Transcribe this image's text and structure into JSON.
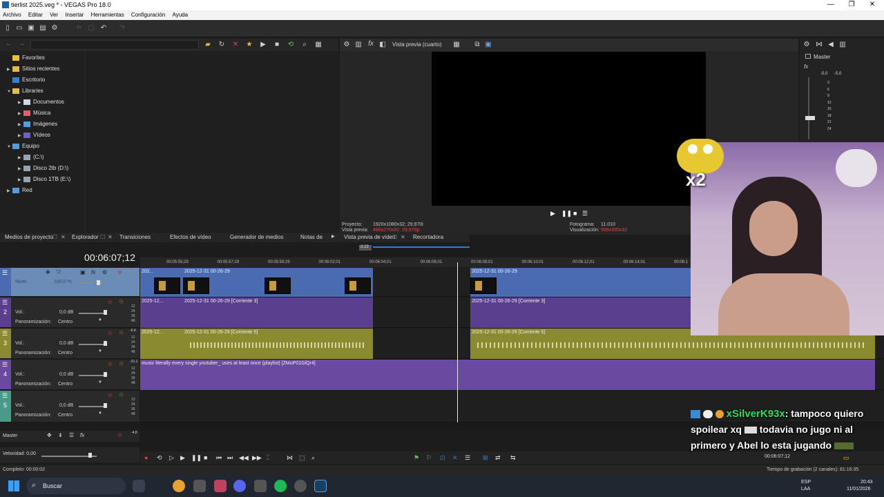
{
  "window": {
    "title": "tierlist 2025.veg * - VEGAS Pro 18.0",
    "controls": [
      "—",
      "❐",
      "✕"
    ]
  },
  "menu": [
    "Archivo",
    "Editar",
    "Ver",
    "Insertar",
    "Herramientas",
    "Configuración",
    "Ayuda"
  ],
  "explorer": {
    "tree": [
      {
        "label": "Favorites",
        "level": 1,
        "icon": "star-icon"
      },
      {
        "label": "Sitios recientes",
        "level": 1,
        "icon": "folder-icon"
      },
      {
        "label": "Escritorio",
        "level": 1,
        "icon": "desktop-icon"
      },
      {
        "label": "Libraries",
        "level": 1,
        "icon": "folder-icon"
      },
      {
        "label": "Documentos",
        "level": 2,
        "icon": "documents-icon"
      },
      {
        "label": "Música",
        "level": 2,
        "icon": "music-icon"
      },
      {
        "label": "Imágenes",
        "level": 2,
        "icon": "images-icon"
      },
      {
        "label": "Vídeos",
        "level": 2,
        "icon": "videos-icon"
      },
      {
        "label": "Equipo",
        "level": 1,
        "icon": "computer-icon"
      },
      {
        "label": "(C:\\)",
        "level": 2,
        "icon": "drive-icon"
      },
      {
        "label": "Disco 2tb (D:\\)",
        "level": 2,
        "icon": "drive-icon"
      },
      {
        "label": "Disco 1TB (E:\\)",
        "level": 2,
        "icon": "drive-icon"
      },
      {
        "label": "Red",
        "level": 1,
        "icon": "network-icon"
      }
    ]
  },
  "tabs": {
    "items": [
      "Medios de proyecto",
      "Explorador",
      "Transiciones",
      "Efectos de vídeo",
      "Generador de medios",
      "Notas de"
    ],
    "preview_tabs": [
      "Vista previa de vídeo",
      "Recortadora"
    ]
  },
  "preview": {
    "mode_label": "Vista previa (cuarto)",
    "project_label": "Proyecto:",
    "project_value": "1920x1080x32; 29,970i",
    "preview_label": "Vista previa:",
    "preview_value": "480x270x32; 29,970p",
    "frame_label": "Fotograma:",
    "frame_value": "11.010",
    "display_label": "Visualización:",
    "display_value": "596x335x32"
  },
  "master_bus": {
    "label": "Master",
    "peak_left": "-5,0",
    "peak_right": "-5,0",
    "scale": [
      "3",
      "6",
      "9",
      "12",
      "15",
      "18",
      "21",
      "24"
    ]
  },
  "timeline": {
    "timecode": "00:06:07;12",
    "ruler": [
      "00:05:55;29",
      "00:05:57;29",
      "00:05:59;29",
      "00:06:02;01",
      "00:06:04;01",
      "00:06:06;01",
      "00:06:08;01",
      "00:06:10;01",
      "00:06:12;01",
      "00:06:14;01",
      "00:06:1"
    ],
    "cursor_flag": "-3:23",
    "video_track": {
      "level_label": "Nivel:",
      "level_value": "100,0 %"
    },
    "audio_tracks": [
      {
        "num": "2",
        "vol_label": "Vol.:",
        "vol_value": "0,0 dB",
        "pan_label": "Panoramización:",
        "pan_value": "Centro"
      },
      {
        "num": "3",
        "vol_label": "Vol.:",
        "vol_value": "0,0 dB",
        "pan_label": "Panoramización:",
        "pan_value": "Centro",
        "peak": "-6,4"
      },
      {
        "num": "4",
        "vol_label": "Vol.:",
        "vol_value": "0,0 dB",
        "pan_label": "Panoramización:",
        "pan_value": "Centro",
        "peak": "-31,1"
      },
      {
        "num": "5",
        "vol_label": "Vol.:",
        "vol_value": "0,0 dB",
        "pan_label": "Panoramización:",
        "pan_value": "Centro"
      }
    ],
    "db_scale": [
      "12",
      "24",
      "36",
      "48"
    ],
    "clips": {
      "video_a": "202...",
      "video_b": "2025-12-31 00-26-29",
      "video_c": "2025-12-31 00-26-29",
      "audio2_a": "2025-12...",
      "audio2_b": "2025-12-31 00-26-29 [Corriente 3]",
      "audio2_c": "2025-12-31 00-26-29 [Corriente 3]",
      "audio3_a": "2025-12...",
      "audio3_b": "2025-12-31 00-26-29 [Corriente 5]",
      "audio3_c": "2025-12-31 00-26-29 [Corriente 5]",
      "audio4_a": "music literally every single youtuber_ uses at least once (playlist) [ZMuP01GlQr4]"
    },
    "master_label": "Master",
    "master_peak": "-4,8",
    "speed_label": "Velocidad: 0,00",
    "end_timecode": "00:06:07;12"
  },
  "status": {
    "left": "Completo: 00:00:02",
    "right": "Tiempo de grabación (2 canales): 81:16:35"
  },
  "taskbar": {
    "search": "Buscar",
    "lang": "ESP",
    "lang2": "LAA",
    "time": "20:43",
    "date": "11/01/2026"
  },
  "overlay": {
    "emote_text": "x2",
    "chat_user": "xSilverK93x",
    "chat_line1": ": tampoco quiero",
    "chat_line2": "spoilear xq",
    "chat_line2b": "todavia no jugo ni al",
    "chat_line3": "primero y Abel lo esta jugando"
  },
  "colors": {
    "video_track": "#4a6bb0",
    "audio_track_purple": "#5a3f8f",
    "audio_track_olive": "#8a8a30",
    "audio_track_violet": "#6a4aa0",
    "accent": "#2d7fd4"
  }
}
